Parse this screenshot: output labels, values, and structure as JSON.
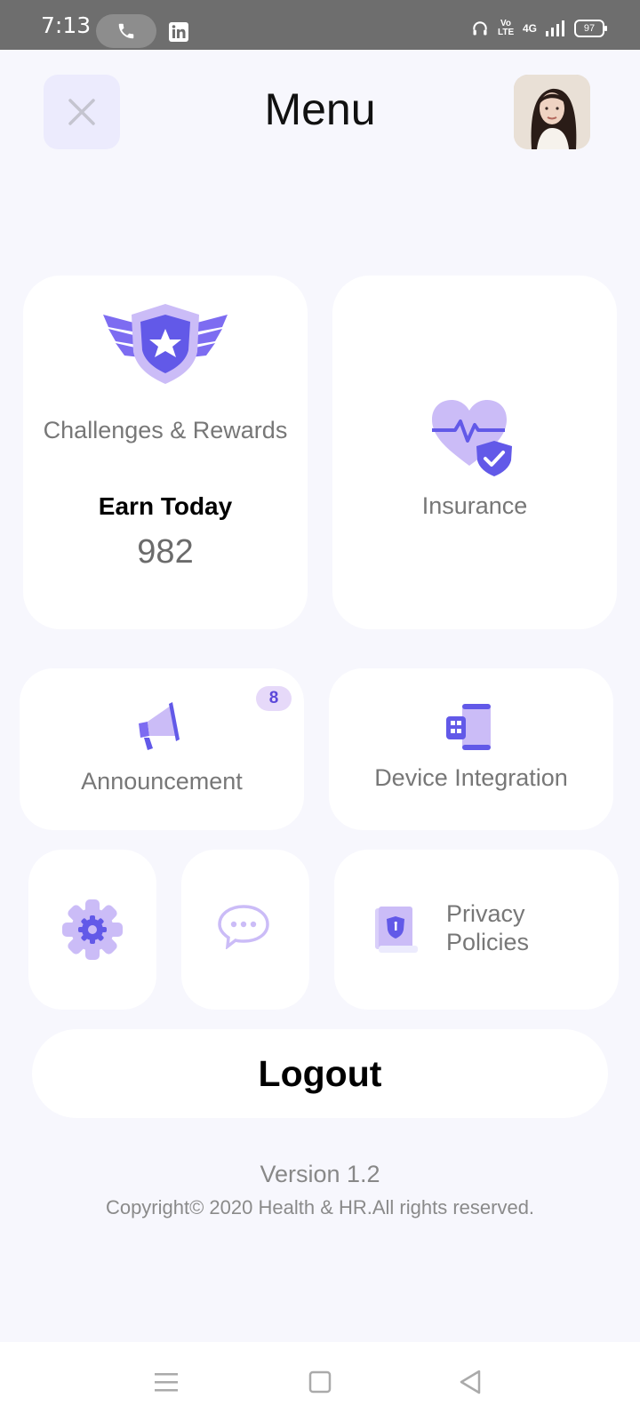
{
  "status_bar": {
    "time": "7:13",
    "volte": "Vo LTE",
    "network": "4G",
    "battery": "97",
    "icons": [
      "phone-call-icon",
      "linkedin-icon",
      "headphones-icon",
      "signal-icon",
      "battery-icon"
    ]
  },
  "header": {
    "title": "Menu",
    "close_icon": "close-icon",
    "avatar": "profile-avatar"
  },
  "menu": {
    "challenges": {
      "label": "Challenges & Rewards",
      "sublabel": "Earn Today",
      "value": "982",
      "icon": "shield-star-icon"
    },
    "insurance": {
      "label": "Insurance",
      "icon": "heart-pulse-shield-icon"
    },
    "announcement": {
      "label": "Announcement",
      "badge": "8",
      "icon": "megaphone-icon"
    },
    "device_integration": {
      "label": "Device Integration",
      "icon": "phone-watch-icon"
    },
    "settings": {
      "icon": "gear-icon"
    },
    "chat": {
      "icon": "chat-bubble-icon"
    },
    "privacy": {
      "label": "Privacy Policies",
      "icon": "document-shield-icon"
    }
  },
  "logout_label": "Logout",
  "footer": {
    "version": "Version 1.2",
    "copyright": "Copyright© 2020 Health & HR.All rights reserved."
  },
  "nav_bar": {
    "icons": [
      "menu-icon",
      "home-square-icon",
      "back-triangle-icon"
    ]
  },
  "colors": {
    "accent": "#6259e8",
    "accent_light": "#cbbcf7",
    "background": "#f7f7fd"
  }
}
